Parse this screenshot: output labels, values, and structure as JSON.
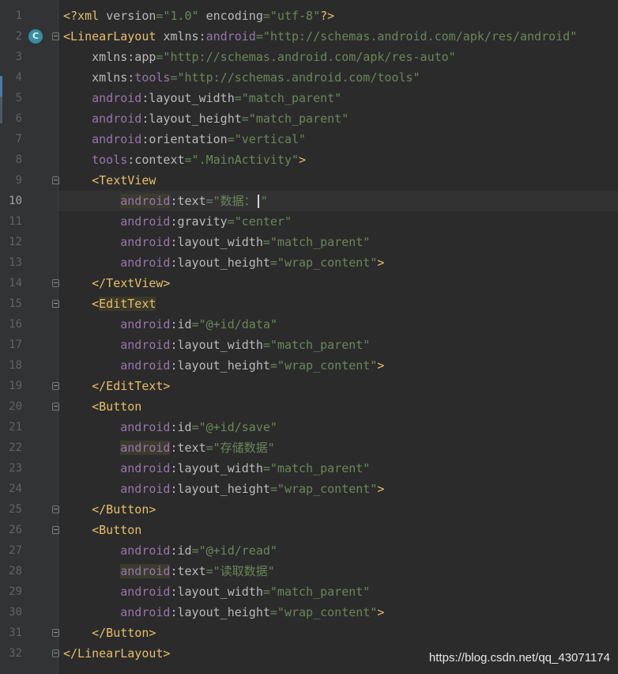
{
  "editor": {
    "current_line": 10,
    "badge_label": "C",
    "lines": [
      {
        "n": "1",
        "segs": [
          [
            "xmlhead",
            "<?xml "
          ],
          [
            "attr",
            "version"
          ],
          [
            "str",
            "=\"1.0\""
          ],
          [
            "attr",
            " encoding"
          ],
          [
            "str",
            "=\"utf-8\""
          ],
          [
            "xmlhead",
            "?>"
          ]
        ]
      },
      {
        "n": "2",
        "segs": [
          [
            "bracket",
            "<LinearLayout "
          ],
          [
            "attr",
            "xmlns:"
          ],
          [
            "ns",
            "android"
          ],
          [
            "str",
            "=\"http://schemas.android.com/apk/res/android\""
          ]
        ]
      },
      {
        "n": "3",
        "segs": [
          [
            "attr",
            "    xmlns:app"
          ],
          [
            "str",
            "=\"http://schemas.android.com/apk/res-auto\""
          ]
        ]
      },
      {
        "n": "4",
        "segs": [
          [
            "attr",
            "    xmlns:"
          ],
          [
            "ns",
            "tools"
          ],
          [
            "str",
            "=\"http://schemas.android.com/tools\""
          ]
        ]
      },
      {
        "n": "5",
        "segs": [
          [
            "ns",
            "    android"
          ],
          [
            "attr",
            ":layout_width"
          ],
          [
            "str",
            "=\"match_parent\""
          ]
        ]
      },
      {
        "n": "6",
        "segs": [
          [
            "ns",
            "    android"
          ],
          [
            "attr",
            ":layout_height"
          ],
          [
            "str",
            "=\"match_parent\""
          ]
        ]
      },
      {
        "n": "7",
        "segs": [
          [
            "ns",
            "    android"
          ],
          [
            "attr",
            ":orientation"
          ],
          [
            "str",
            "=\"vertical\""
          ]
        ]
      },
      {
        "n": "8",
        "segs": [
          [
            "ns",
            "    tools"
          ],
          [
            "attr",
            ":context"
          ],
          [
            "str",
            "=\".MainActivity\""
          ],
          [
            "bracket",
            ">"
          ]
        ]
      },
      {
        "n": "9",
        "segs": [
          [
            "bracket",
            "    <TextView"
          ]
        ]
      },
      {
        "n": "10",
        "segs": [
          [
            "ns",
            "        android"
          ],
          [
            "attr",
            ":text"
          ],
          [
            "str",
            "=\"数据："
          ],
          [
            "caret",
            ""
          ],
          [
            "str",
            "\""
          ]
        ]
      },
      {
        "n": "11",
        "segs": [
          [
            "ns",
            "        android"
          ],
          [
            "attr",
            ":gravity"
          ],
          [
            "str",
            "=\"center\""
          ]
        ]
      },
      {
        "n": "12",
        "segs": [
          [
            "ns",
            "        android"
          ],
          [
            "attr",
            ":layout_width"
          ],
          [
            "str",
            "=\"match_parent\""
          ]
        ]
      },
      {
        "n": "13",
        "segs": [
          [
            "ns",
            "        android"
          ],
          [
            "attr",
            ":layout_height"
          ],
          [
            "str",
            "=\"wrap_content\""
          ],
          [
            "bracket",
            ">"
          ]
        ]
      },
      {
        "n": "14",
        "segs": [
          [
            "bracket",
            "    </TextView>"
          ]
        ]
      },
      {
        "n": "15",
        "segs": [
          [
            "bracket",
            "    <EditText"
          ]
        ]
      },
      {
        "n": "16",
        "segs": [
          [
            "ns",
            "        android"
          ],
          [
            "attr",
            ":id"
          ],
          [
            "str",
            "=\"@+id/data\""
          ]
        ]
      },
      {
        "n": "17",
        "segs": [
          [
            "ns",
            "        android"
          ],
          [
            "attr",
            ":layout_width"
          ],
          [
            "str",
            "=\"match_parent\""
          ]
        ]
      },
      {
        "n": "18",
        "segs": [
          [
            "ns",
            "        android"
          ],
          [
            "attr",
            ":layout_height"
          ],
          [
            "str",
            "=\"wrap_content\""
          ],
          [
            "bracket",
            ">"
          ]
        ]
      },
      {
        "n": "19",
        "segs": [
          [
            "bracket",
            "    </EditText>"
          ]
        ]
      },
      {
        "n": "20",
        "segs": [
          [
            "bracket",
            "    <Button"
          ]
        ]
      },
      {
        "n": "21",
        "segs": [
          [
            "ns",
            "        android"
          ],
          [
            "attr",
            ":id"
          ],
          [
            "str",
            "=\"@+id/save\""
          ]
        ]
      },
      {
        "n": "22",
        "segs": [
          [
            "ns",
            "        android"
          ],
          [
            "attr",
            ":text"
          ],
          [
            "str",
            "=\"存储数据\""
          ]
        ]
      },
      {
        "n": "23",
        "segs": [
          [
            "ns",
            "        android"
          ],
          [
            "attr",
            ":layout_width"
          ],
          [
            "str",
            "=\"match_parent\""
          ]
        ]
      },
      {
        "n": "24",
        "segs": [
          [
            "ns",
            "        android"
          ],
          [
            "attr",
            ":layout_height"
          ],
          [
            "str",
            "=\"wrap_content\""
          ],
          [
            "bracket",
            ">"
          ]
        ]
      },
      {
        "n": "25",
        "segs": [
          [
            "bracket",
            "    </Button>"
          ]
        ]
      },
      {
        "n": "26",
        "segs": [
          [
            "bracket",
            "    <Button"
          ]
        ]
      },
      {
        "n": "27",
        "segs": [
          [
            "ns",
            "        android"
          ],
          [
            "attr",
            ":id"
          ],
          [
            "str",
            "=\"@+id/read\""
          ]
        ]
      },
      {
        "n": "28",
        "segs": [
          [
            "ns",
            "        android"
          ],
          [
            "attr",
            ":text"
          ],
          [
            "str",
            "=\"读取数据\""
          ]
        ]
      },
      {
        "n": "29",
        "segs": [
          [
            "ns",
            "        android"
          ],
          [
            "attr",
            ":layout_width"
          ],
          [
            "str",
            "=\"match_parent\""
          ]
        ]
      },
      {
        "n": "30",
        "segs": [
          [
            "ns",
            "        android"
          ],
          [
            "attr",
            ":layout_height"
          ],
          [
            "str",
            "=\"wrap_content\""
          ],
          [
            "bracket",
            ">"
          ]
        ]
      },
      {
        "n": "31",
        "segs": [
          [
            "bracket",
            "    </Button>"
          ]
        ]
      },
      {
        "n": "32",
        "segs": [
          [
            "bracket",
            "</LinearLayout>"
          ]
        ]
      }
    ]
  },
  "watermark": "https://blog.csdn.net/qq_43071174"
}
